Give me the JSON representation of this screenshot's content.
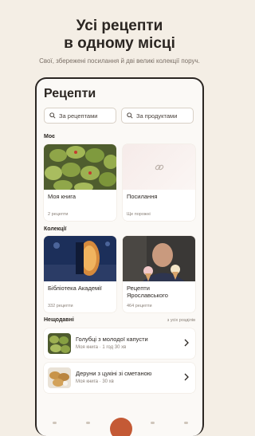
{
  "promo": {
    "title_line1": "Усі рецепти",
    "title_line2": "в одному місці",
    "subtitle": "Свої, збережені посилання й дві великі колекції поруч."
  },
  "screen": {
    "title": "Рецепти",
    "search_recipes": "За рецептами",
    "search_products": "За продуктами"
  },
  "mine": {
    "section": "Моє",
    "cards": [
      {
        "name": "Моя книга",
        "count": "2 рецепти"
      },
      {
        "name": "Посилання",
        "count": "Ще порожні"
      }
    ]
  },
  "collections": {
    "section": "Колекції",
    "cards": [
      {
        "name": "Бібліотека Академії",
        "count": "332 рецепти"
      },
      {
        "name": "Рецепти Ярославського",
        "count": "464 рецепти"
      }
    ]
  },
  "recent": {
    "section": "Нещодавні",
    "see_all": "з усіх розділів",
    "items": [
      {
        "title": "Голубці з молодої капусти",
        "meta": "Моя книга · 1 год 30 хв"
      },
      {
        "title": "Деруни з цукіні зі сметаною",
        "meta": "Моя книга · 30 хв"
      }
    ]
  },
  "colors": {
    "background": "#f4eee5",
    "accent": "#c45a35",
    "text": "#2b2622"
  },
  "icons": [
    "search-icon",
    "link-icon",
    "chevron-right-icon"
  ]
}
